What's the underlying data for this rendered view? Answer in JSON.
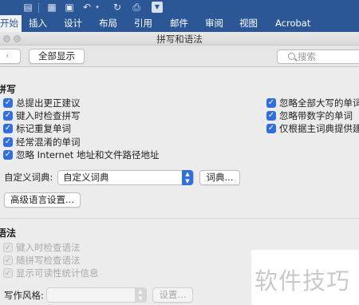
{
  "ribbon": {
    "tabs": [
      {
        "label": "开始",
        "active": true
      },
      {
        "label": "插入"
      },
      {
        "label": "设计"
      },
      {
        "label": "布局"
      },
      {
        "label": "引用"
      },
      {
        "label": "邮件"
      },
      {
        "label": "审阅"
      },
      {
        "label": "视图"
      },
      {
        "label": "Acrobat"
      }
    ],
    "accent_color": "#2b5797"
  },
  "window": {
    "title": "拼写和语法",
    "show_all_label": "全部显示",
    "search_placeholder": "搜索"
  },
  "spelling": {
    "heading": "拼写",
    "left_options": [
      {
        "label": "总提出更正建议",
        "checked": true
      },
      {
        "label": "键入时检查拼写",
        "checked": true
      },
      {
        "label": "标记重复单词",
        "checked": true
      },
      {
        "label": "经常混淆的单词",
        "checked": true
      },
      {
        "label": "忽略 Internet 地址和文件路径地址",
        "checked": true
      }
    ],
    "right_options": [
      {
        "label": "忽略全部大写的单词",
        "checked": true
      },
      {
        "label": "忽略带数字的单词",
        "checked": true
      },
      {
        "label": "仅根据主词典提供建议",
        "checked": true
      }
    ],
    "custom_dictionary_label": "自定义词典:",
    "custom_dictionary_value": "自定义词典",
    "dictionary_button": "词典...",
    "language_settings_button": "高级语言设置..."
  },
  "grammar": {
    "heading": "语法",
    "options": [
      {
        "label": "键入时检查语法",
        "checked": true
      },
      {
        "label": "随拼写检查语法",
        "checked": true
      },
      {
        "label": "显示可读性统计信息",
        "checked": true
      }
    ],
    "writing_style_label": "写作风格:",
    "settings_button": "设置..."
  },
  "watermark_text": "软件技巧"
}
